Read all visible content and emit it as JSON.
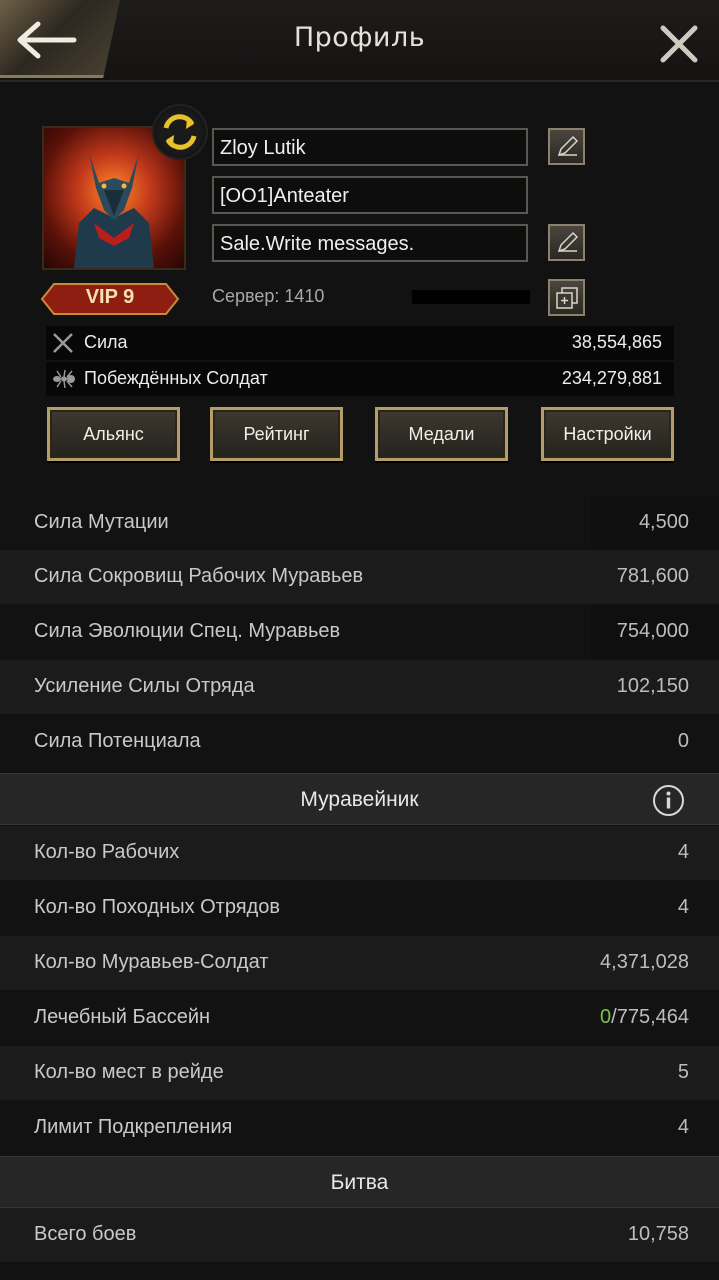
{
  "header": {
    "title": "Профиль"
  },
  "profile": {
    "name": "Zloy Lutik",
    "alliance_tag": "[OO1]Anteater",
    "signature": "Sale.Write messages.",
    "vip": "VIP 9",
    "server": "Сервер: 1410",
    "stats": [
      {
        "label": "Сила",
        "value": "38,554,865",
        "icon": "crossed-swords-icon"
      },
      {
        "label": "Побеждённых Солдат",
        "value": "234,279,881",
        "icon": "ant-icon"
      }
    ],
    "tabs": [
      "Альянс",
      "Рейтинг",
      "Медали",
      "Настройки"
    ]
  },
  "list": {
    "top_rows": [
      {
        "label": "Сила Мутации",
        "value": "4,500"
      },
      {
        "label": "Сила Сокровищ Рабочих Муравьев",
        "value": "781,600"
      },
      {
        "label": "Сила Эволюции Спец. Муравьев",
        "value": "754,000"
      },
      {
        "label": "Усиление Силы Отряда",
        "value": "102,150"
      },
      {
        "label": "Сила Потенциала",
        "value": "0"
      }
    ],
    "anthill_title": "Муравейник",
    "anthill_rows": [
      {
        "label": "Кол-во Рабочих",
        "value": "4"
      },
      {
        "label": "Кол-во Походных Отрядов",
        "value": "4"
      },
      {
        "label": "Кол-во Муравьев-Солдат",
        "value": "4,371,028"
      },
      {
        "label": "Лечебный Бассейн",
        "value_green": "0",
        "value": "/775,464"
      },
      {
        "label": "Кол-во мест в рейде",
        "value": "5"
      },
      {
        "label": "Лимит Подкрепления",
        "value": "4"
      }
    ],
    "battle_title": "Битва",
    "battle_rows": [
      {
        "label": "Всего боев",
        "value": "10,758"
      }
    ]
  },
  "colors": {
    "accent_gold": "#b59d6a",
    "positive_green": "#79c24e",
    "vip_red": "#8e1d12"
  }
}
